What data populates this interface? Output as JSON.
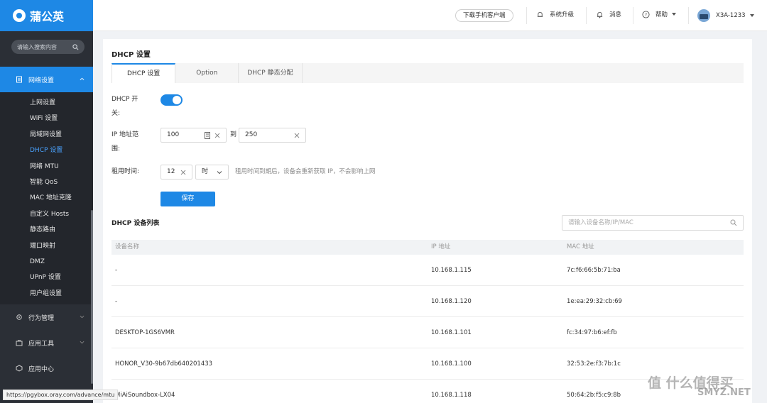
{
  "app": {
    "logo_text": "蒲公英"
  },
  "sidebar": {
    "search_placeholder": "请输入搜索内容",
    "groups": [
      {
        "label": "网络设置"
      },
      {
        "label": "行为管理"
      },
      {
        "label": "应用工具"
      },
      {
        "label": "应用中心"
      }
    ],
    "network_items": [
      "上网设置",
      "WiFi 设置",
      "局域网设置",
      "DHCP 设置",
      "网络 MTU",
      "智能 QoS",
      "MAC 地址克隆",
      "自定义 Hosts",
      "静态路由",
      "端口映射",
      "DMZ",
      "UPnP 设置",
      "用户组设置"
    ],
    "active_item": "DHCP 设置"
  },
  "topbar": {
    "download_label": "下载手机客户端",
    "upgrade_label": "系统升级",
    "messages_label": "消息",
    "help_label": "帮助",
    "device_label": "X3A-1233"
  },
  "page": {
    "title": "DHCP 设置",
    "tabs": [
      "DHCP 设置",
      "Option",
      "DHCP 静态分配"
    ],
    "active_tab": "DHCP 设置"
  },
  "form": {
    "dhcp_label_1": "DHCP 开",
    "dhcp_label_2": "关:",
    "dhcp_enabled": true,
    "ip_label_1": "IP 地址范",
    "ip_label_2": "围:",
    "ip_start": "100",
    "ip_to": "到",
    "ip_end": "250",
    "lease_label": "租用时间:",
    "lease_value": "12",
    "lease_unit": "时",
    "lease_hint": "租用时间到期后，设备会重新获取 IP，不会影响上网",
    "save_label": "保存"
  },
  "device_list": {
    "title": "DHCP 设备列表",
    "search_placeholder": "请输入设备名称/IP/MAC",
    "columns": [
      "设备名称",
      "IP 地址",
      "MAC 地址"
    ],
    "rows": [
      [
        "-",
        "10.168.1.115",
        "7c:f6:66:5b:71:ba"
      ],
      [
        "-",
        "10.168.1.120",
        "1e:ea:29:32:cb:69"
      ],
      [
        "DESKTOP-1GS6VMR",
        "10.168.1.101",
        "fc:34:97:b6:ef:fb"
      ],
      [
        "HONOR_V30-9b67db640201433",
        "10.168.1.100",
        "32:53:2e:f3:7b:1c"
      ],
      [
        "MiAiSoundbox-LX04",
        "10.168.1.118",
        "50:64:2b:f5:c9:8b"
      ]
    ]
  },
  "status_bar": {
    "url": "https://pgybox.oray.com/advance/mtu"
  },
  "watermark": {
    "text": "值 什么值得买",
    "sub": "SMYZ.NET"
  }
}
